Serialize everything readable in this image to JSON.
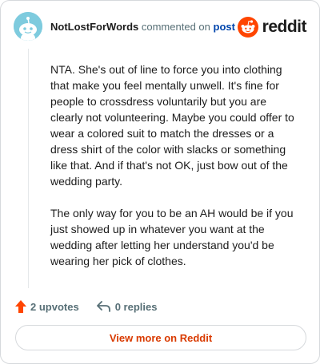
{
  "comment": {
    "author": "NotLostForWords",
    "action_text": "commented on",
    "post_link": "post",
    "paragraphs": [
      "NTA. She's out of line to force you into clothing that make you feel mentally unwell. It's fine for people to crossdress voluntarily but you are clearly not volunteering. Maybe you could offer to wear a colored suit to match the dresses or a dress shirt of the color with slacks or something like that. And if that's not OK, just bow out of the wedding party.",
      "The only way for you to be an AH would be if you just showed up in whatever you want at the wedding after letting her understand you'd be wearing her pick of clothes."
    ],
    "upvotes": "2 upvotes",
    "replies": "0 replies"
  },
  "brand": {
    "name": "reddit",
    "icon": "reddit-snoo-icon",
    "color": "#ff4500"
  },
  "view_button_label": "View more on Reddit",
  "colors": {
    "upvote_icon": "#ff4500",
    "link": "#0045ac",
    "button_text": "#d93a00",
    "avatar_bg": "#7ecbde"
  }
}
